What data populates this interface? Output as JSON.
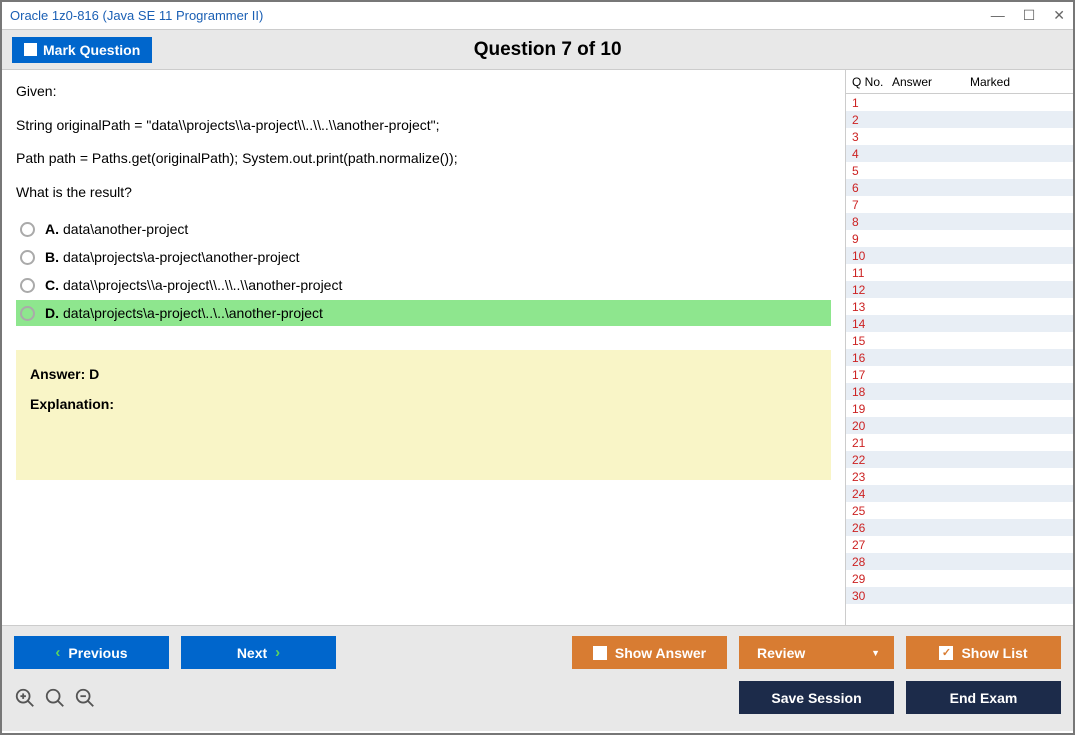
{
  "window": {
    "title": "Oracle 1z0-816 (Java SE 11 Programmer II)"
  },
  "header": {
    "mark_label": "Mark Question",
    "question_title": "Question 7 of 10"
  },
  "question": {
    "line1": "Given:",
    "line2": "String originalPath = \"data\\\\projects\\\\a-project\\\\..\\\\..\\\\another-project\";",
    "line3": "Path path = Paths.get(originalPath); System.out.print(path.normalize());",
    "line4": "What is the result?"
  },
  "options": {
    "a_letter": "A.",
    "a_text": "data\\another-project",
    "b_letter": "B.",
    "b_text": "data\\projects\\a-project\\another-project",
    "c_letter": "C.",
    "c_text": "data\\\\projects\\\\a-project\\\\..\\\\..\\\\another-project",
    "d_letter": "D.",
    "d_text": "data\\projects\\a-project\\..\\..\\another-project"
  },
  "answer_box": {
    "answer": "Answer: D",
    "explanation": "Explanation:"
  },
  "sidebar": {
    "hdr_qno": "Q No.",
    "hdr_ans": "Answer",
    "hdr_marked": "Marked",
    "rows": [
      "1",
      "2",
      "3",
      "4",
      "5",
      "6",
      "7",
      "8",
      "9",
      "10",
      "11",
      "12",
      "13",
      "14",
      "15",
      "16",
      "17",
      "18",
      "19",
      "20",
      "21",
      "22",
      "23",
      "24",
      "25",
      "26",
      "27",
      "28",
      "29",
      "30"
    ]
  },
  "footer": {
    "previous": "Previous",
    "next": "Next",
    "show_answer": "Show Answer",
    "review": "Review",
    "show_list": "Show List",
    "save_session": "Save Session",
    "end_exam": "End Exam"
  }
}
